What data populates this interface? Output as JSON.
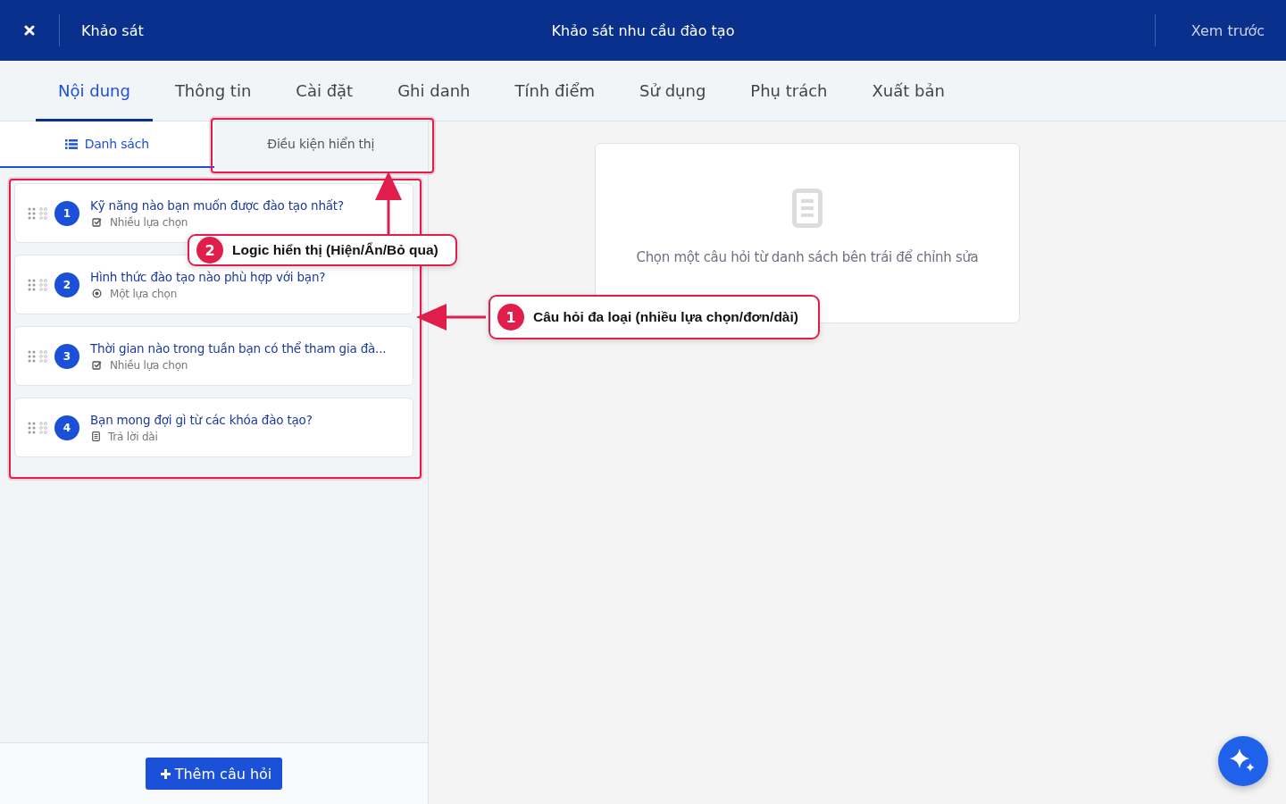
{
  "header": {
    "section": "Khảo sát",
    "title": "Khảo sát nhu cầu đào tạo",
    "preview": "Xem trước"
  },
  "tabs": [
    {
      "label": "Nội dung",
      "selected": true
    },
    {
      "label": "Thông tin",
      "selected": false
    },
    {
      "label": "Cài đặt",
      "selected": false
    },
    {
      "label": "Ghi danh",
      "selected": false
    },
    {
      "label": "Tính điểm",
      "selected": false
    },
    {
      "label": "Sử dụng",
      "selected": false
    },
    {
      "label": "Phụ trách",
      "selected": false
    },
    {
      "label": "Xuất bản",
      "selected": false
    }
  ],
  "subtabs": [
    {
      "label": "Danh sách",
      "selected": true
    },
    {
      "label": "Điều kiện hiển thị",
      "selected": false
    }
  ],
  "questions": [
    {
      "number": "1",
      "title": "Kỹ năng nào bạn muốn được đào tạo nhất?",
      "kind": "multiple",
      "type_label": "Nhiều lựa chọn"
    },
    {
      "number": "2",
      "title": "Hình thức đào tạo nào phù hợp với bạn?",
      "kind": "single",
      "type_label": "Một lựa chọn"
    },
    {
      "number": "3",
      "title": "Thời gian nào trong tuần bạn có thể tham gia đà...",
      "kind": "multiple",
      "type_label": "Nhiều lựa chọn"
    },
    {
      "number": "4",
      "title": "Bạn mong đợi gì từ các khóa đào tạo?",
      "kind": "long",
      "type_label": "Trả lời dài"
    }
  ],
  "add_button": "Thêm câu hỏi",
  "empty_state": "Chọn một câu hỏi từ danh sách bên trái để chỉnh sửa",
  "annotations": [
    {
      "number": "1",
      "text": "Câu hỏi đa loại (nhiều lựa chọn/đơn/dài)"
    },
    {
      "number": "2",
      "text": "Logic hiển thị (Hiện/Ẩn/Bỏ qua)"
    }
  ]
}
